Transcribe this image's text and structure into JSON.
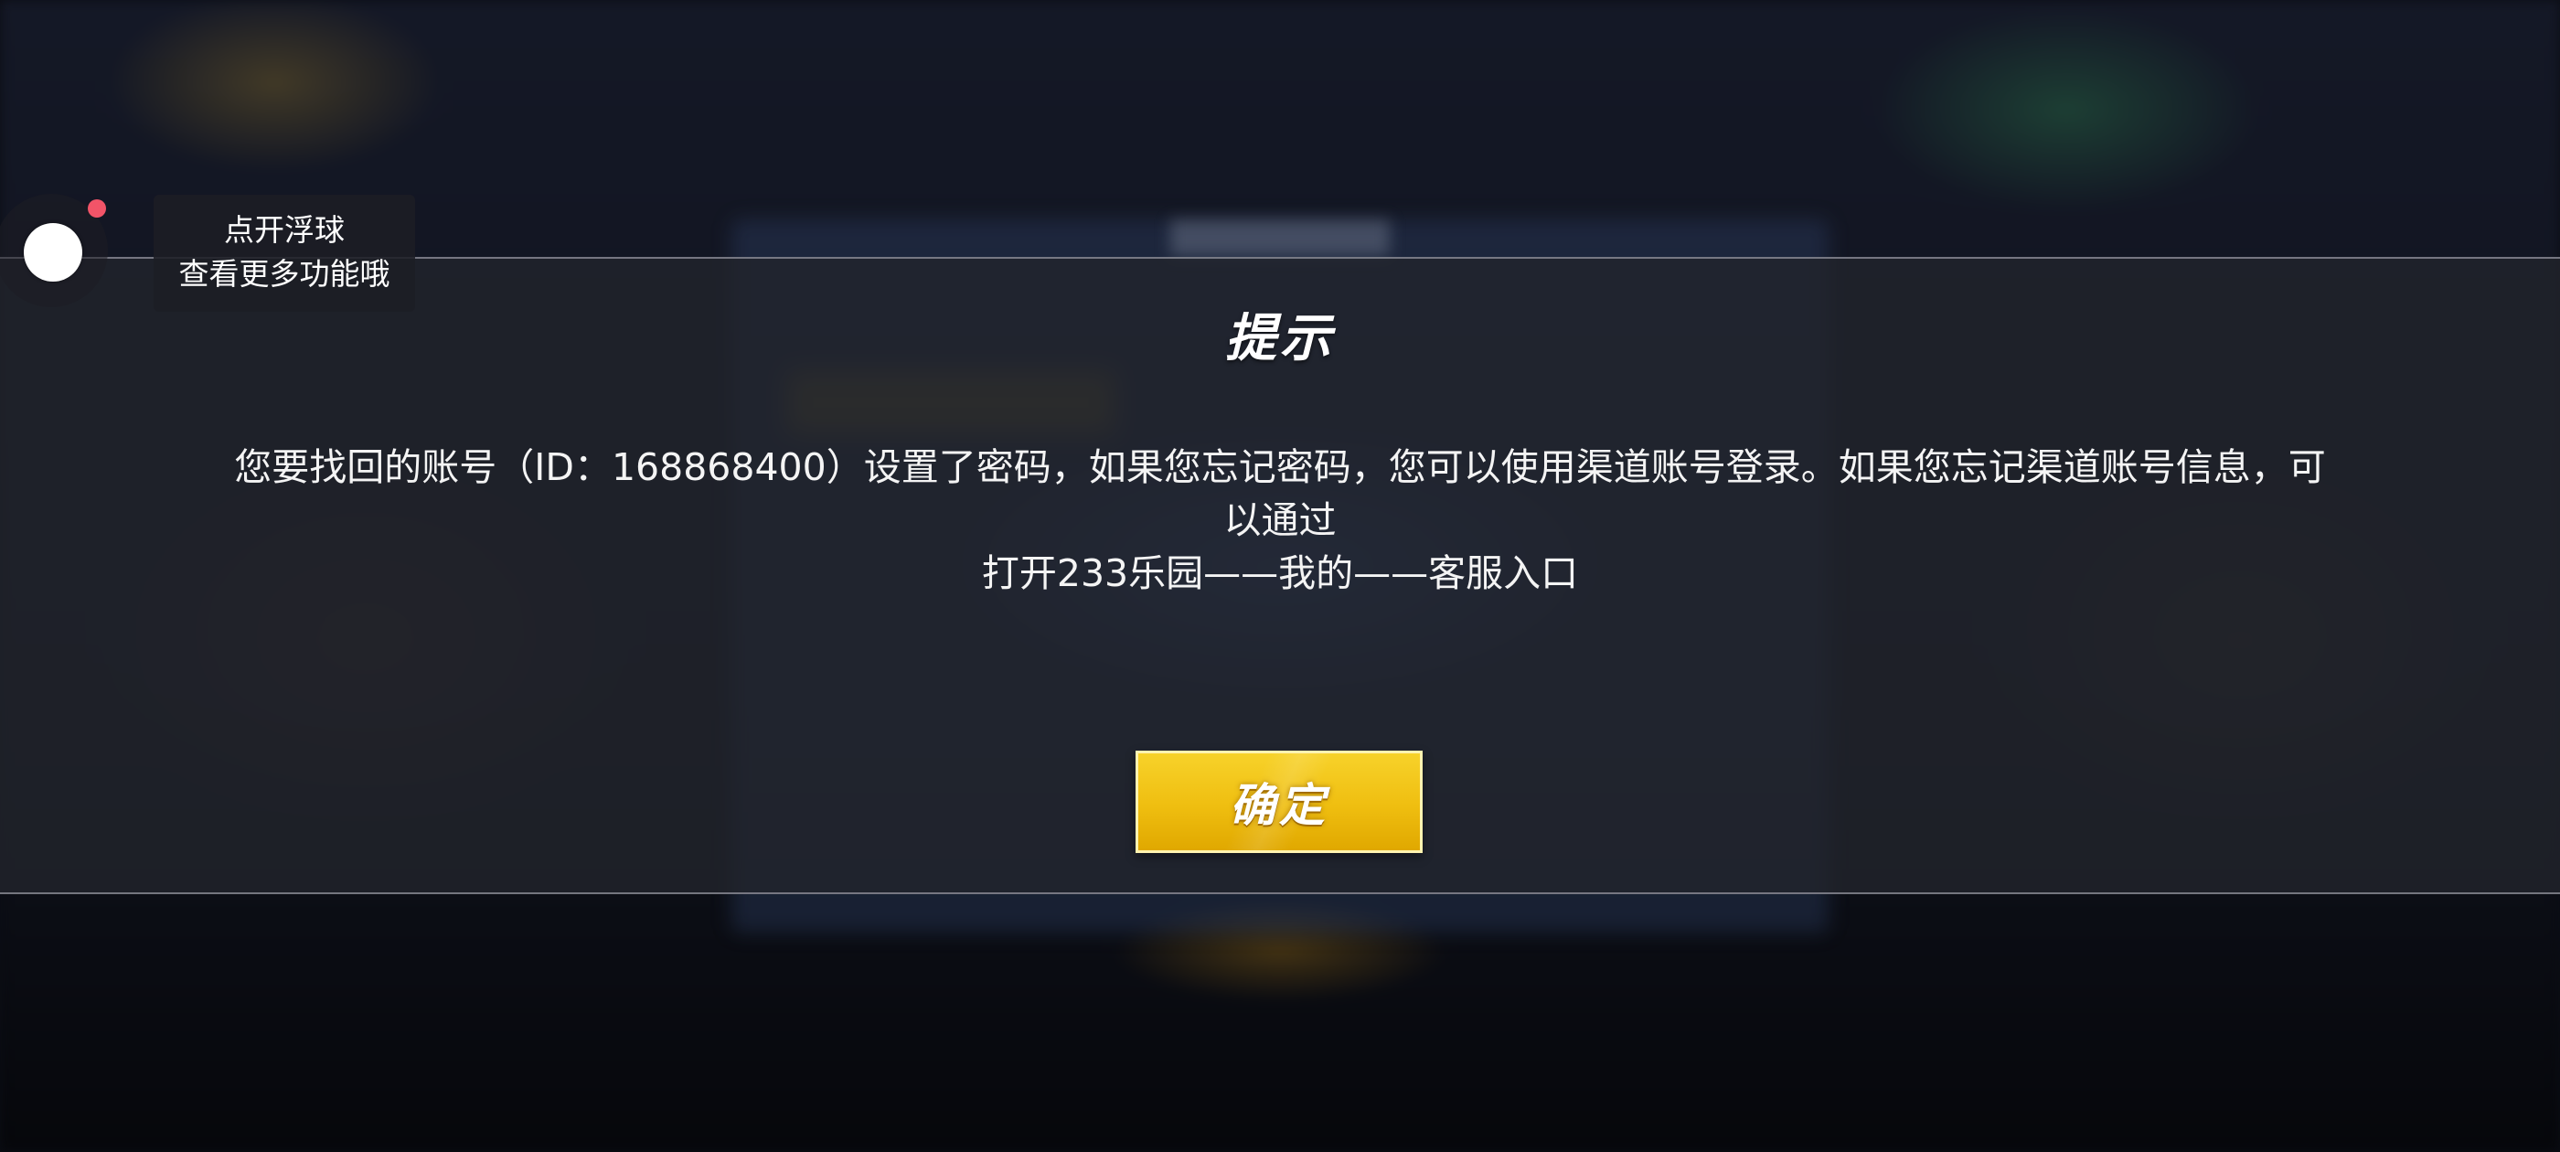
{
  "floating_ball": {
    "tip_line1": "点开浮球",
    "tip_line2": "查看更多功能哦",
    "notification_dot_color": "#f25468"
  },
  "dialog": {
    "title": "提示",
    "message_line1": "您要找回的账号（ID：168868400）设置了密码，如果您忘记密码，您可以使用渠道账号登录。如果您忘记渠道账号信息，可",
    "message_line2": "以通过",
    "message_line3": "打开233乐园——我的——客服入口",
    "confirm_label": "确定",
    "confirm_color": "#efbe10"
  }
}
